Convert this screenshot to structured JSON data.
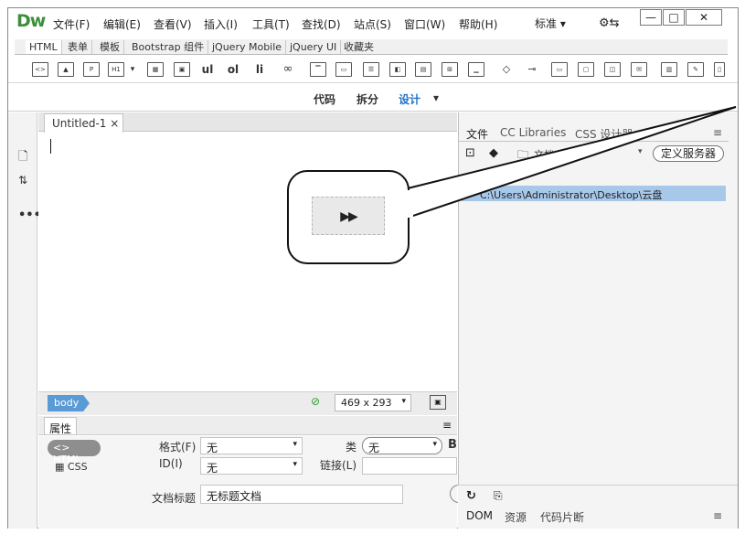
{
  "app": {
    "logo": "Dw"
  },
  "menu": [
    "文件(F)",
    "编辑(E)",
    "查看(V)",
    "插入(I)",
    "工具(T)",
    "查找(D)",
    "站点(S)",
    "窗口(W)",
    "帮助(H)"
  ],
  "layout_selector": "标准 ▾",
  "window_buttons": {
    "minimize": "—",
    "maximize": "□",
    "close": "✕"
  },
  "insert_tabs": [
    "HTML",
    "表单",
    "模板",
    "Bootstrap 组件",
    "jQuery Mobile",
    "jQuery UI",
    "收藏夹"
  ],
  "insert_tools": [
    "ul",
    "ol",
    "li"
  ],
  "view_modes": {
    "code": "代码",
    "split": "拆分",
    "design": "设计",
    "dropdown": "▾"
  },
  "document": {
    "tab_title": "Untitled-1 ×"
  },
  "statusbar": {
    "tag": "body",
    "size": "469 x 293"
  },
  "properties": {
    "tab": "属性",
    "html_btn": "<> HTML",
    "css_btn": "CSS",
    "format_label": "格式(F)",
    "format_value": "无",
    "id_label": "ID(I)",
    "id_value": "无",
    "class_label": "类",
    "class_value": "无",
    "link_label": "链接(L)",
    "title_label": "文档标题",
    "title_value": "无标题文档"
  },
  "files_panel": {
    "tabs": [
      "文件",
      "CC Libraries",
      "CSS 设计器"
    ],
    "site_dropdown": "文档",
    "define_server": "定义服务器",
    "selected_path": "C:\\Users\\Administrator\\Desktop\\云盘",
    "bottom_tabs": [
      "DOM",
      "资源",
      "代码片断"
    ]
  }
}
